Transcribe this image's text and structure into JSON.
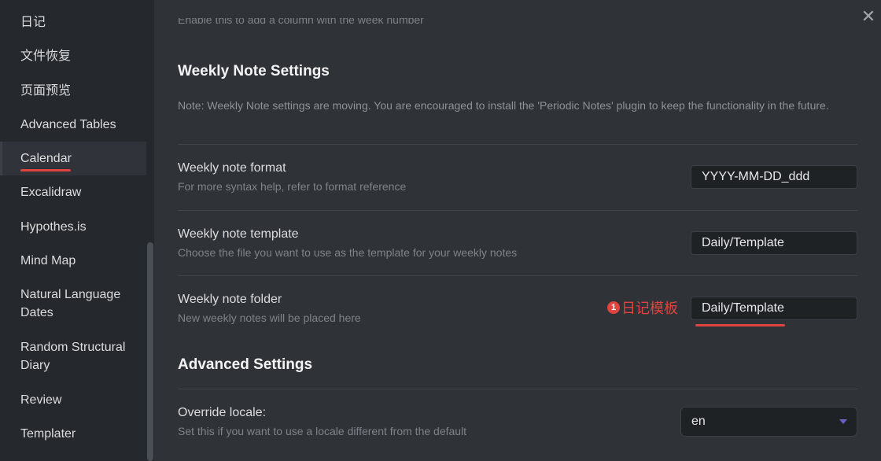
{
  "sidebar": {
    "items": [
      {
        "label": "日记"
      },
      {
        "label": "文件恢复"
      },
      {
        "label": "页面预览"
      },
      {
        "label": "Advanced Tables"
      },
      {
        "label": "Calendar"
      },
      {
        "label": "Excalidraw"
      },
      {
        "label": "Hypothes.is"
      },
      {
        "label": "Mind Map"
      },
      {
        "label": "Natural Language Dates"
      },
      {
        "label": "Random Structural Diary"
      },
      {
        "label": "Review"
      },
      {
        "label": "Templater"
      }
    ],
    "active_item": "Calendar"
  },
  "main": {
    "close_icon": "close-icon",
    "faded_top_text": "Enable this to add a column with the week number",
    "weekly_section": {
      "heading": "Weekly Note Settings",
      "note": "Note: Weekly Note settings are moving. You are encouraged to install the 'Periodic Notes' plugin to keep the functionality in the future.",
      "format": {
        "name": "Weekly note format",
        "desc": "For more syntax help, refer to format reference",
        "value": "YYYY-MM-DD_ddd"
      },
      "template": {
        "name": "Weekly note template",
        "desc": "Choose the file you want to use as the template for your weekly notes",
        "value": "Daily/Template"
      },
      "folder": {
        "name": "Weekly note folder",
        "desc": "New weekly notes will be placed here",
        "value": "Daily/Template"
      }
    },
    "annotation": {
      "number": "1",
      "text": "日记模板",
      "color": "#e0443e"
    },
    "advanced_section": {
      "heading": "Advanced Settings",
      "locale": {
        "name": "Override locale:",
        "desc": "Set this if you want to use a locale different from the default",
        "value": "en"
      }
    }
  }
}
